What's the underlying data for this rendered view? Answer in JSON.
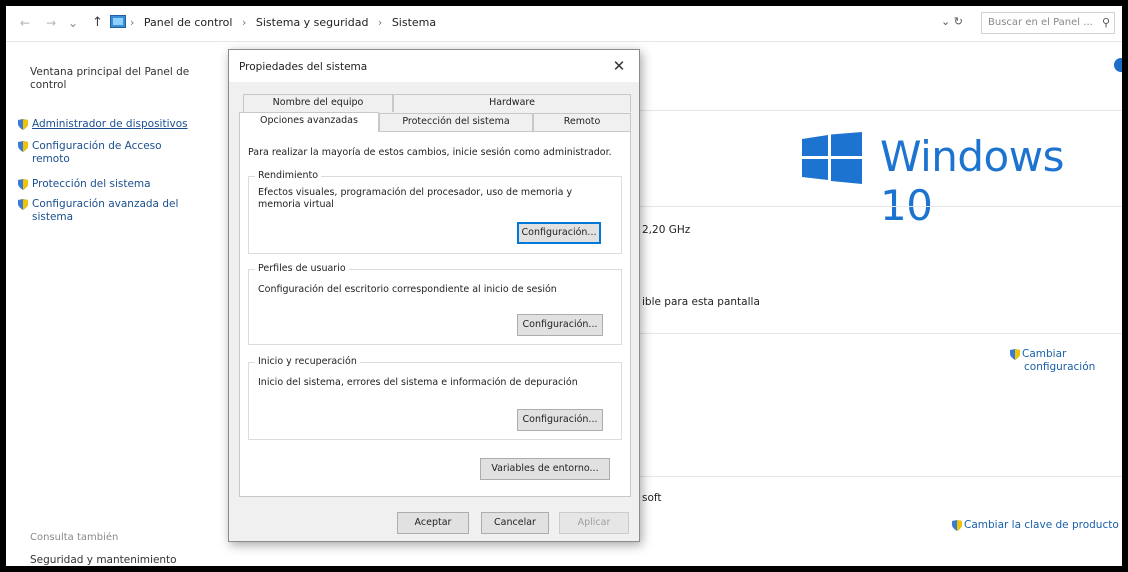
{
  "address_bar": {
    "back": "←",
    "forward": "→",
    "up": "↑",
    "breadcrumbs": [
      "Panel de control",
      "Sistema y seguridad",
      "Sistema"
    ],
    "separator": "›",
    "refresh": "⌄ ↻",
    "search_placeholder": "Buscar en el Panel ...",
    "search_icon": "⚲"
  },
  "left_pane": {
    "home_link": "Ventana principal del Panel de control",
    "items": [
      {
        "label": "Administrador de dispositivos",
        "icon": "shield-icon"
      },
      {
        "label": "Configuración de Acceso remoto",
        "icon": "shield-icon"
      },
      {
        "label": "Protección del sistema",
        "icon": "shield-icon"
      },
      {
        "label": "Configuración avanzada del sistema",
        "icon": "shield-icon"
      }
    ],
    "see_also": "Consulta también",
    "security_link": "Seguridad y mantenimiento"
  },
  "background": {
    "logo_text": "Windows 10",
    "processor_speed": "2,20 GHz",
    "pen_touch": "ible para esta pantalla",
    "change_settings": [
      "Cambiar",
      "configuración"
    ],
    "microsoft": "soft",
    "change_product_key": "Cambiar la clave de producto",
    "brand_color": "#1d74d0"
  },
  "dialog": {
    "title": "Propiedades del sistema",
    "close": "✕",
    "tabs_top": [
      "Nombre del equipo",
      "Hardware"
    ],
    "tabs_bottom": [
      "Opciones avanzadas",
      "Protección del sistema",
      "Remoto"
    ],
    "active_tab": "Opciones avanzadas",
    "admin_note": "Para realizar la mayoría de estos cambios, inicie sesión como administrador.",
    "groups": [
      {
        "title": "Rendimiento",
        "description": "Efectos visuales, programación del procesador, uso de memoria y memoria virtual",
        "button": "Configuración..."
      },
      {
        "title": "Perfiles de usuario",
        "description": "Configuración del escritorio correspondiente al inicio de sesión",
        "button": "Configuración..."
      },
      {
        "title": "Inicio y recuperación",
        "description": "Inicio del sistema, errores del sistema e información de depuración",
        "button": "Configuración..."
      }
    ],
    "env_button": "Variables de entorno...",
    "ok": "Aceptar",
    "cancel": "Cancelar",
    "apply": "Aplicar"
  }
}
